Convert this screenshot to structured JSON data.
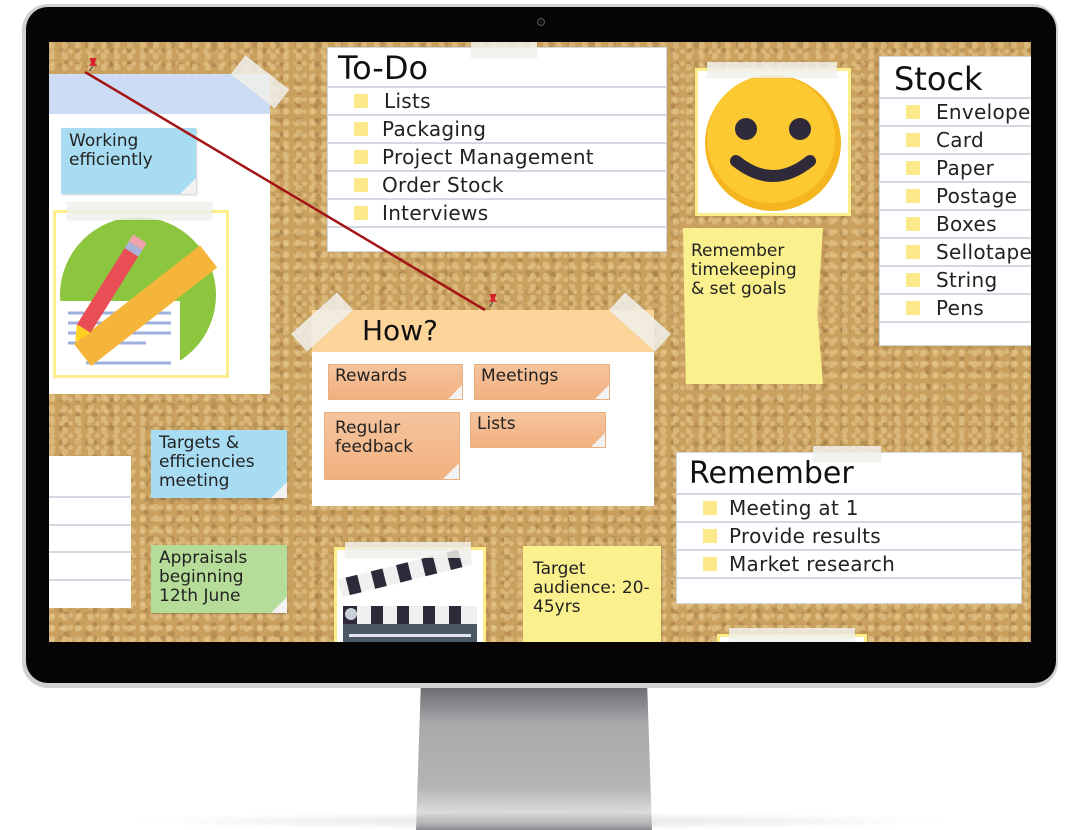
{
  "board": {
    "todo": {
      "title": "To-Do",
      "items": [
        "Lists",
        "Packaging",
        "Project Management",
        "Order Stock",
        "Interviews"
      ]
    },
    "stock": {
      "title": "Stock",
      "items": [
        "Envelope",
        "Card",
        "Paper",
        "Postage",
        "Boxes",
        "Sellotape",
        "String",
        "Pens"
      ]
    },
    "how": {
      "title": "How?",
      "notes": [
        "Rewards",
        "Meetings",
        "Regular feedback",
        "Lists"
      ]
    },
    "remember": {
      "title": "Remember",
      "items": [
        "Meeting at 1",
        "Provide results",
        "Market research"
      ]
    },
    "stickies": {
      "working": "Working efficiently",
      "timekeeping": "Remember timekeeping & set goals",
      "targets": "Targets & efficiencies meeting",
      "appraisals": "Appraisals beginning 12th June",
      "audience": "Target audience: 20-45yrs"
    },
    "icons": {
      "smiley": "smiley-face-icon",
      "pencil": "pencil-ruler-icon",
      "clapper": "clapperboard-icon",
      "pin": "push-pin-icon"
    },
    "colors": {
      "cork": "#c9a05e",
      "sticky_blue": "#a8dcf2",
      "sticky_yellow": "#fbf08e",
      "sticky_green": "#b6dc9a",
      "sticky_orange": "#f2b98a",
      "header_orange": "#fdd59a",
      "header_lavender": "#cddcf5",
      "bullet": "#fce98a",
      "string": "#a31515"
    }
  }
}
